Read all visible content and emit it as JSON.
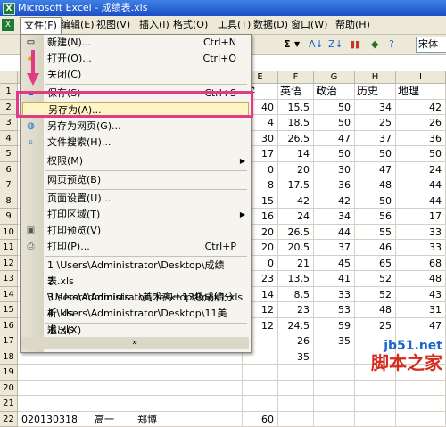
{
  "window": {
    "title": "Microsoft Excel - 成绩表.xls",
    "app_icon": "excel-icon"
  },
  "menubar": {
    "items": [
      "文件(F)",
      "编辑(E)",
      "视图(V)",
      "插入(I)",
      "格式(O)",
      "工具(T)",
      "数据(D)",
      "窗口(W)",
      "帮助(H)"
    ],
    "active": "文件(F)"
  },
  "toolbar": {
    "sum_label": "Σ",
    "font_name": "宋体"
  },
  "columns": [
    "E",
    "F",
    "G",
    "H",
    "I"
  ],
  "header_row": [
    "学",
    "英语",
    "政治",
    "历史",
    "地理"
  ],
  "row_numbers": [
    "1",
    "2",
    "3",
    "4",
    "5",
    "6",
    "7",
    "8",
    "9",
    "10",
    "11",
    "12",
    "13",
    "14",
    "15",
    "16",
    "17",
    "18",
    "19",
    "20",
    "21",
    "22"
  ],
  "rows": [
    [
      "40",
      "15.5",
      "50",
      "34",
      "42"
    ],
    [
      "4",
      "18.5",
      "50",
      "25",
      "26"
    ],
    [
      "30",
      "26.5",
      "47",
      "37",
      "36"
    ],
    [
      "17",
      "14",
      "50",
      "50",
      "50"
    ],
    [
      "0",
      "20",
      "30",
      "47",
      "24"
    ],
    [
      "8",
      "17.5",
      "36",
      "48",
      "44"
    ],
    [
      "15",
      "42",
      "42",
      "50",
      "44"
    ],
    [
      "16",
      "24",
      "34",
      "56",
      "17"
    ],
    [
      "20",
      "26.5",
      "44",
      "55",
      "33"
    ],
    [
      "20",
      "20.5",
      "37",
      "46",
      "33"
    ],
    [
      "0",
      "21",
      "45",
      "65",
      "68"
    ],
    [
      "23",
      "13.5",
      "41",
      "52",
      "48"
    ],
    [
      "14",
      "8.5",
      "33",
      "52",
      "43"
    ],
    [
      "12",
      "23",
      "53",
      "48",
      "31"
    ],
    [
      "12",
      "24.5",
      "59",
      "25",
      "47"
    ],
    [
      "",
      "26",
      "35",
      "",
      ""
    ],
    [
      "",
      "35",
      "",
      "",
      ""
    ]
  ],
  "bottom_row": {
    "id": "020130318",
    "grade": "高一",
    "name": "郑博",
    "e": "60"
  },
  "file_menu": {
    "items": [
      {
        "label": "新建(N)...",
        "shortcut": "Ctrl+N",
        "icon": "new-doc-icon"
      },
      {
        "label": "打开(O)...",
        "shortcut": "Ctrl+O",
        "icon": "folder-open-icon"
      },
      {
        "label": "关闭(C)",
        "shortcut": "",
        "icon": ""
      },
      {
        "label": "保存(S)",
        "shortcut": "Ctrl+S",
        "icon": "save-icon"
      },
      {
        "label": "另存为(A)...",
        "shortcut": "",
        "icon": ""
      },
      {
        "label": "另存为网页(G)...",
        "shortcut": "",
        "icon": "save-web-icon"
      },
      {
        "label": "文件搜索(H)...",
        "shortcut": "",
        "icon": "file-search-icon"
      },
      {
        "label": "权限(M)",
        "shortcut": "",
        "icon": ""
      },
      {
        "label": "网页预览(B)",
        "shortcut": "",
        "icon": ""
      },
      {
        "label": "页面设置(U)...",
        "shortcut": "",
        "icon": ""
      },
      {
        "label": "打印区域(T)",
        "shortcut": "",
        "icon": ""
      },
      {
        "label": "打印预览(V)",
        "shortcut": "",
        "icon": "print-preview-icon"
      },
      {
        "label": "打印(P)...",
        "shortcut": "Ctrl+P",
        "icon": "printer-icon"
      },
      {
        "label": "1 \\Users\\Administrator\\Desktop\\成绩表.xls",
        "shortcut": "",
        "icon": ""
      },
      {
        "label": "2 \\Users\\Administrator\\Desktop\\Book1.xls",
        "shortcut": "",
        "icon": ""
      },
      {
        "label": "3 \\Users\\Adminis...\\美术高一13级成绩分析.xls",
        "shortcut": "",
        "icon": ""
      },
      {
        "label": "4 \\Users\\Administrator\\Desktop\\11美术.xls",
        "shortcut": "",
        "icon": ""
      },
      {
        "label": "退出(X)",
        "shortcut": "",
        "icon": ""
      }
    ],
    "expand_glyph": "»"
  },
  "colors": {
    "highlight_box": "#e23a86",
    "menu_hover": "#fdf6c4",
    "title_blue": "#1d4fc4"
  },
  "watermark": {
    "line1": "jb51.net",
    "line2": "脚本之家"
  }
}
